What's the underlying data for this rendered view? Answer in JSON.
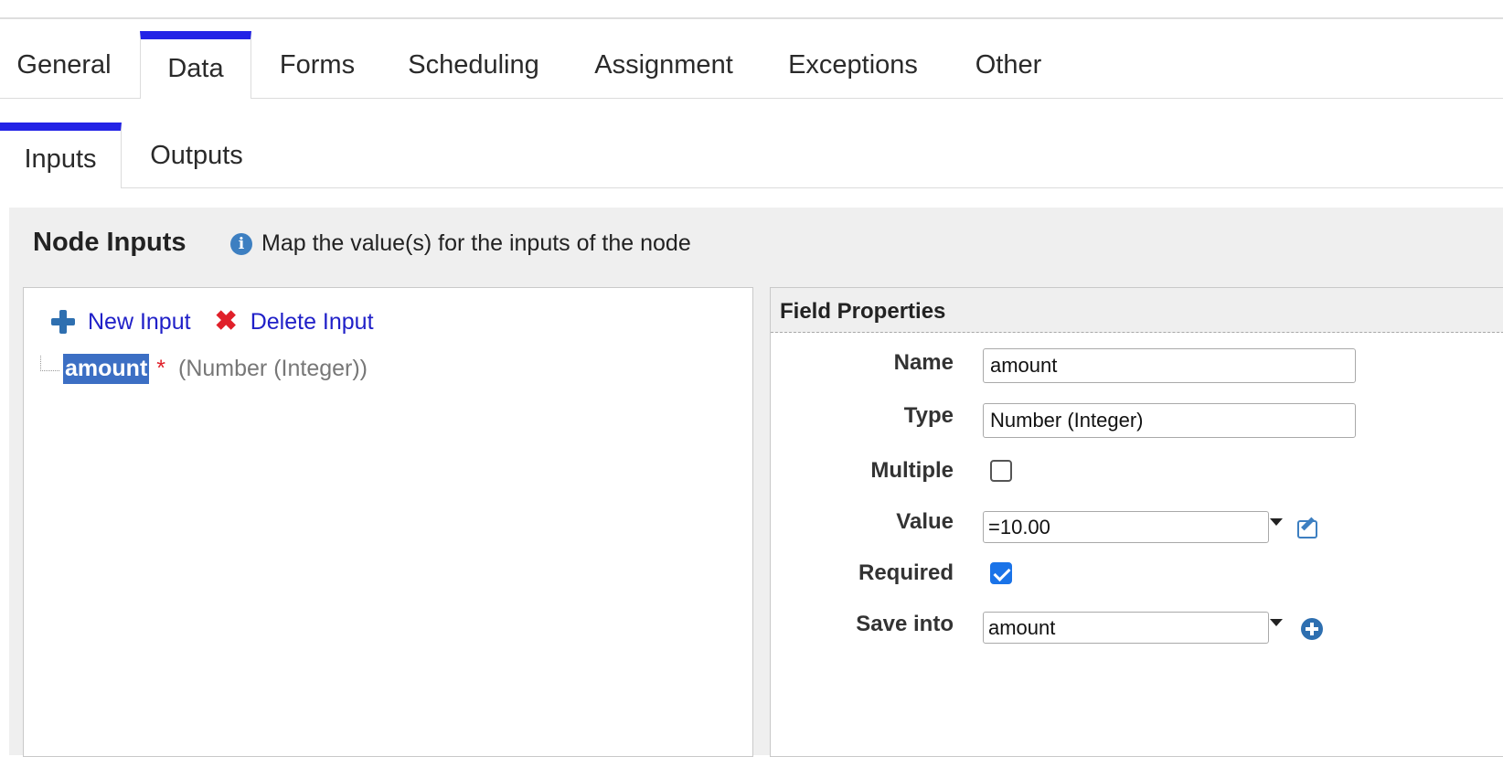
{
  "tabs": [
    {
      "label": "General"
    },
    {
      "label": "Data"
    },
    {
      "label": "Forms"
    },
    {
      "label": "Scheduling"
    },
    {
      "label": "Assignment"
    },
    {
      "label": "Exceptions"
    },
    {
      "label": "Other"
    }
  ],
  "active_tab": "Data",
  "subtabs": [
    {
      "label": "Inputs"
    },
    {
      "label": "Outputs"
    }
  ],
  "active_subtab": "Inputs",
  "panel": {
    "title": "Node Inputs",
    "hint": "Map the value(s) for the inputs of the node"
  },
  "toolbar": {
    "new_input": "New Input",
    "delete_input": "Delete Input"
  },
  "tree": {
    "item_name": "amount",
    "required_marker": "*",
    "item_type": "(Number (Integer))"
  },
  "field_properties": {
    "title": "Field Properties",
    "name_label": "Name",
    "name_value": "amount",
    "type_label": "Type",
    "type_value": "Number (Integer)",
    "multiple_label": "Multiple",
    "multiple_checked": false,
    "value_label": "Value",
    "value_value": "=10.00",
    "required_label": "Required",
    "required_checked": true,
    "save_into_label": "Save into",
    "save_into_value": "amount"
  },
  "colors": {
    "accent": "#2323e6",
    "link": "#2020c8",
    "selection": "#3c6fc4",
    "danger": "#e0202a",
    "checkbox": "#1a73e8"
  }
}
